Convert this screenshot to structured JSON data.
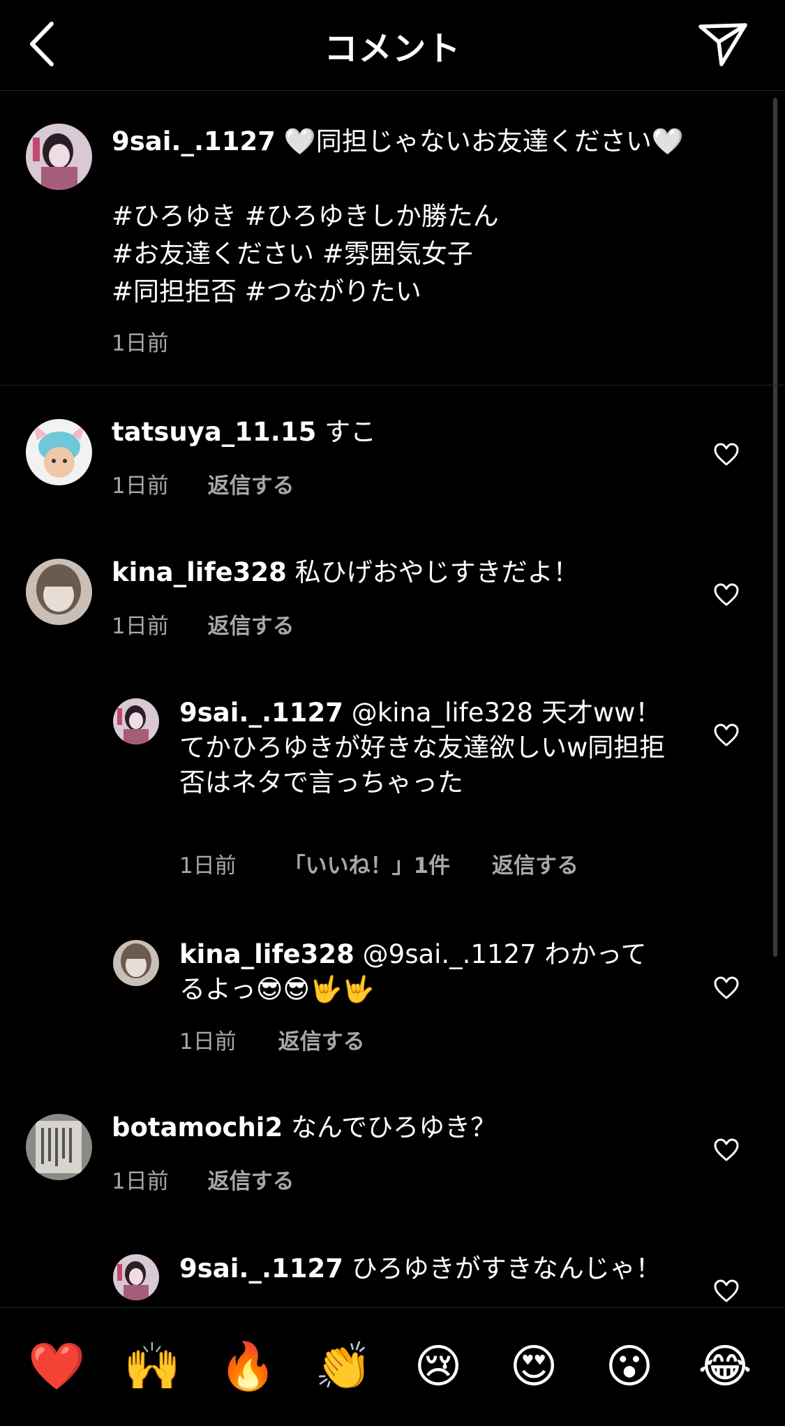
{
  "header": {
    "title": "コメント"
  },
  "caption": {
    "username": "9sai._.1127",
    "text": " 🤍同担じゃないお友達ください🤍",
    "hashtags": [
      "#ひろゆき #ひろゆきしか勝たん",
      "#お友達ください #雰囲気女子",
      "#同担拒否 #つながりたい"
    ],
    "time": "1日前"
  },
  "comments": [
    {
      "username": "tatsuya_11.15",
      "text": " すこ",
      "time": "1日前",
      "reply": "返信する"
    },
    {
      "username": "kina_life328",
      "text": " 私ひげおやじすきだよ！",
      "time": "1日前",
      "reply": "返信する"
    },
    {
      "username": "9sai._.1127",
      "text": " @kina_life328 天才ww！\nてかひろゆきが好きな友達欲しいw同担拒否はネタで言っちゃった",
      "time": "1日前",
      "likes": "「いいね！」1件",
      "reply": "返信する"
    },
    {
      "username": "kina_life328",
      "text": " @9sai._.1127 わかってるよっ😎😎🤟🤟",
      "time": "1日前",
      "reply": "返信する"
    },
    {
      "username": "botamochi2",
      "text": " なんでひろゆき？",
      "time": "1日前",
      "reply": "返信する"
    },
    {
      "username": "9sai._.1127",
      "text": " ひろゆきがすきなんじゃ！"
    }
  ],
  "emoji_bar": [
    "❤️",
    "🙌",
    "🔥",
    "👏",
    "😢",
    "😍",
    "😮",
    "😂"
  ]
}
